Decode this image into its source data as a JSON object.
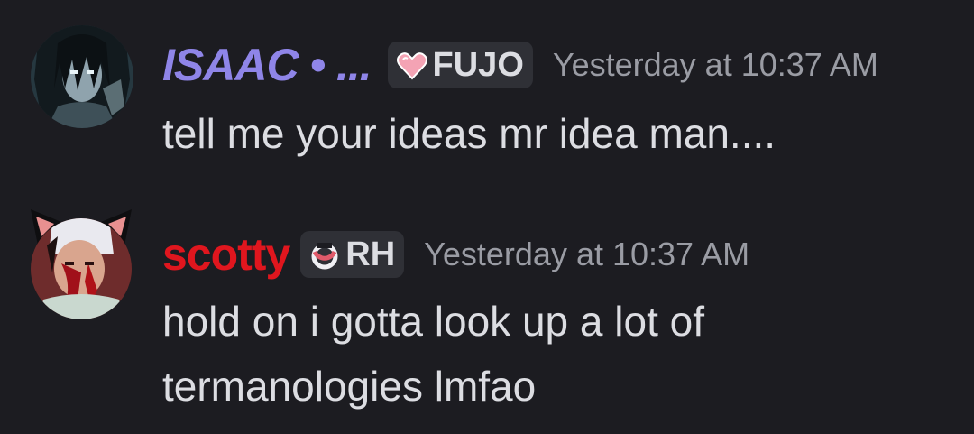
{
  "messages": [
    {
      "username": "ISAAC • ...",
      "role_tag": "FUJO",
      "role_icon": "pink-heart-icon",
      "timestamp": "Yesterday at 10:37 AM",
      "text": "tell me your ideas mr idea man....",
      "name_color": "#8f85e8"
    },
    {
      "username": "scotty",
      "role_tag": "RH",
      "role_icon": "red-ring-icon",
      "timestamp": "Yesterday at 10:37 AM",
      "text_lines": [
        "hold on i gotta look up a lot of",
        "termanologies lmfao"
      ],
      "name_color": "#e0161e"
    }
  ],
  "colors": {
    "background": "#1c1c21",
    "text": "#dcdde2",
    "muted": "#9a9ca4",
    "tag_bg": "#2f3036"
  }
}
